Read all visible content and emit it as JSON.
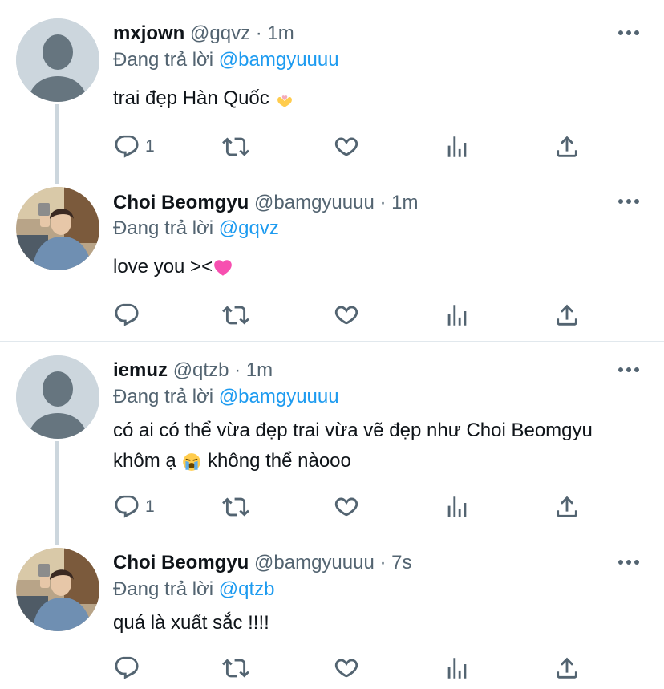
{
  "tweets": [
    {
      "name": "mxjown",
      "handle": "@gqvz",
      "dot": "·",
      "time": "1m",
      "reply_prefix": "Đang trả lời",
      "reply_to": "@bamgyuuuu",
      "text": "trai đẹp Hàn Quốc",
      "reply_count": "1",
      "avatar": "default-avatar"
    },
    {
      "name": "Choi Beomgyu",
      "handle": "@bamgyuuuu",
      "dot": "·",
      "time": "1m",
      "reply_prefix": "Đang trả lời",
      "reply_to": "@gqvz",
      "text": "love you ><",
      "reply_count": "",
      "avatar": "photo-avatar"
    },
    {
      "name": "iemuz",
      "handle": "@qtzb",
      "dot": "·",
      "time": "1m",
      "reply_prefix": "Đang trả lời",
      "reply_to": "@bamgyuuuu",
      "text_line1": "có ai có thể vừa đẹp trai vừa vẽ đẹp như Choi Beomgyu",
      "text_line2_a": "khôm ạ",
      "text_line2_b": "không thể nàooo",
      "reply_count": "1",
      "avatar": "default-avatar"
    },
    {
      "name": "Choi Beomgyu",
      "handle": "@bamgyuuuu",
      "dot": "·",
      "time": "7s",
      "reply_prefix": "Đang trả lời",
      "reply_to": "@qtzb",
      "text": "quá là xuất sắc !!!!",
      "reply_count": "",
      "avatar": "photo-avatar"
    }
  ],
  "colors": {
    "link": "#1d9bf0",
    "secondary_text": "#536471",
    "thread_line": "#ccd6dd",
    "icon": "#536471"
  },
  "icons": [
    "reply-icon",
    "retweet-icon",
    "like-icon",
    "views-icon",
    "share-icon",
    "more-icon"
  ]
}
